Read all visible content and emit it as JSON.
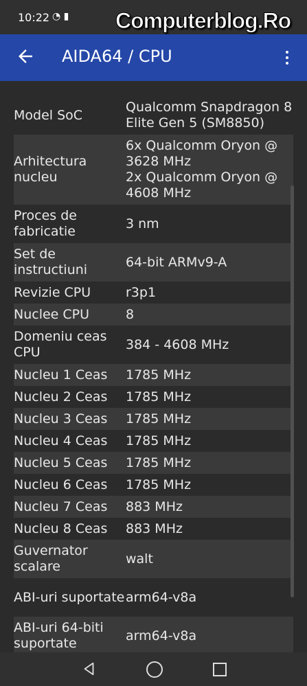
{
  "status": {
    "time": "10:22",
    "icons": "◔ ▮"
  },
  "watermark": "Computerblog.Ro",
  "header": {
    "title": "AIDA64  /  CPU",
    "back_icon": "arrow-left-icon",
    "menu_icon": "more-vert-icon"
  },
  "rows": [
    {
      "label": "Model SoC",
      "value": "Qualcomm Snapdragon 8 Elite Gen 5 (SM8850)",
      "h": 56
    },
    {
      "label": "Arhitectura nucleu",
      "value": "6x Qualcomm Oryon @ 3628 MHz\n2x Qualcomm Oryon @ 4608 MHz",
      "h": 102
    },
    {
      "label": "Proces de fabricatie",
      "value": "3 nm",
      "h": 56
    },
    {
      "label": "Set de instructiuni",
      "value": "64-bit ARMv9-A",
      "h": 56
    },
    {
      "label": "Revizie CPU",
      "value": "r3p1",
      "h": 32
    },
    {
      "label": "Nuclee CPU",
      "value": "8",
      "h": 32
    },
    {
      "label": "Domeniu ceas CPU",
      "value": "384 - 4608 MHz",
      "h": 56
    },
    {
      "label": "Nucleu 1 Ceas",
      "value": "1785 MHz",
      "h": 32
    },
    {
      "label": "Nucleu 2 Ceas",
      "value": "1785 MHz",
      "h": 32
    },
    {
      "label": "Nucleu 3 Ceas",
      "value": "1785 MHz",
      "h": 32
    },
    {
      "label": "Nucleu 4 Ceas",
      "value": "1785 MHz",
      "h": 32
    },
    {
      "label": "Nucleu 5 Ceas",
      "value": "1785 MHz",
      "h": 32
    },
    {
      "label": "Nucleu 6 Ceas",
      "value": "1785 MHz",
      "h": 32
    },
    {
      "label": "Nucleu 7 Ceas",
      "value": "883 MHz",
      "h": 32
    },
    {
      "label": "Nucleu 8 Ceas",
      "value": "883 MHz",
      "h": 32
    },
    {
      "label": "Guvernator scalare",
      "value": "walt",
      "h": 56
    },
    {
      "label": "ABI-uri suportate",
      "value": "arm64-v8a",
      "h": 56
    },
    {
      "label": "ABI-uri 64-biti suportate",
      "value": "arm64-v8a",
      "h": 56
    }
  ],
  "navbar": {
    "back_icon": "nav-back-icon",
    "home_icon": "nav-home-icon",
    "recents_icon": "nav-recents-icon"
  }
}
